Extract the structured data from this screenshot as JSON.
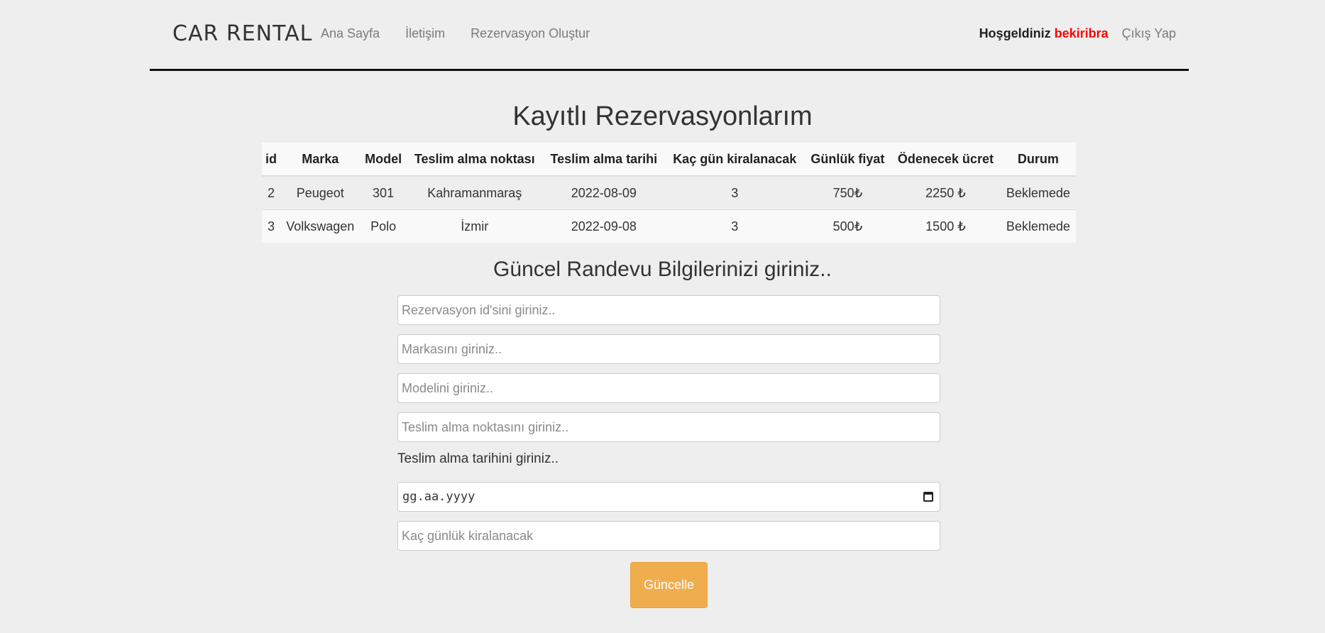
{
  "nav": {
    "brand": "CAR RENTAL",
    "links": [
      "Ana Sayfa",
      "İletişim",
      "Rezervasyon Oluştur"
    ],
    "welcome": "Hoşgeldiniz",
    "username": "bekiribra",
    "logout": "Çıkış Yap"
  },
  "reservations": {
    "title": "Kayıtlı Rezervasyonlarım",
    "columns": [
      "id",
      "Marka",
      "Model",
      "Teslim alma noktası",
      "Teslim alma tarihi",
      "Kaç gün kiralanacak",
      "Günlük fiyat",
      "Ödenecek ücret",
      "Durum"
    ],
    "rows": [
      [
        "2",
        "Peugeot",
        "301",
        "Kahramanmaraş",
        "2022-08-09",
        "3",
        "750₺",
        "2250 ₺",
        "Beklemede"
      ],
      [
        "3",
        "Volkswagen",
        "Polo",
        "İzmir",
        "2022-09-08",
        "3",
        "500₺",
        "1500 ₺",
        "Beklemede"
      ]
    ]
  },
  "form": {
    "title": "Güncel Randevu Bilgilerinizi giriniz..",
    "id_placeholder": "Rezervasyon id'sini giriniz..",
    "brand_placeholder": "Markasını giriniz..",
    "model_placeholder": "Modelini giriniz..",
    "location_placeholder": "Teslim alma noktasını giriniz..",
    "date_label": "Teslim alma tarihini giriniz..",
    "date_placeholder": "gg.aa.yyyy",
    "days_placeholder": "Kaç günlük kiralanacak",
    "submit_label": "Güncelle"
  },
  "colors": {
    "accent_button": "#f0ad4e",
    "username": "#ff0000"
  }
}
